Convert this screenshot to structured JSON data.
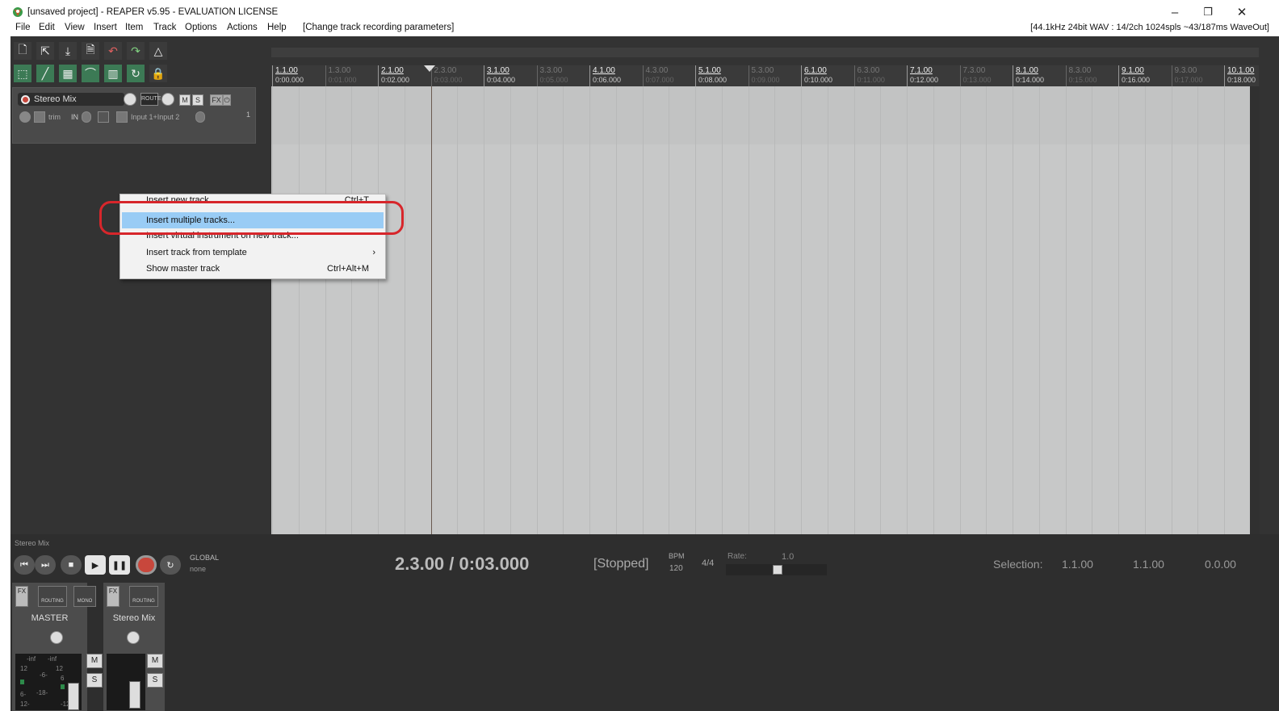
{
  "window": {
    "title": "[unsaved project] - REAPER v5.95 - EVALUATION LICENSE",
    "minimize": "–",
    "restore": "❐",
    "close": "✕"
  },
  "menubar": {
    "items": [
      "File",
      "Edit",
      "View",
      "Insert",
      "Item",
      "Track",
      "Options",
      "Actions",
      "Help"
    ],
    "hint": "[Change track recording parameters]",
    "status": "[44.1kHz 24bit WAV : 14/2ch 1024spls ~43/187ms WaveOut]"
  },
  "track": {
    "name": "Stereo Mix",
    "mute": "M",
    "solo": "S",
    "fx": "FX",
    "route": "ROUTE",
    "trim": "trim",
    "in": "IN",
    "input": "Input 1+Input 2",
    "number": "1"
  },
  "ruler": {
    "marks": [
      {
        "bar": "1.1.00",
        "time": "0:00.000",
        "minor": false
      },
      {
        "bar": "1.3.00",
        "time": "0:01.000",
        "minor": true
      },
      {
        "bar": "2.1.00",
        "time": "0:02.000",
        "minor": false
      },
      {
        "bar": "2.3.00",
        "time": "0:03.000",
        "minor": true
      },
      {
        "bar": "3.1.00",
        "time": "0:04.000",
        "minor": false
      },
      {
        "bar": "3.3.00",
        "time": "0:05.000",
        "minor": true
      },
      {
        "bar": "4.1.00",
        "time": "0:06.000",
        "minor": false
      },
      {
        "bar": "4.3.00",
        "time": "0:07.000",
        "minor": true
      },
      {
        "bar": "5.1.00",
        "time": "0:08.000",
        "minor": false
      },
      {
        "bar": "5.3.00",
        "time": "0:09.000",
        "minor": true
      },
      {
        "bar": "6.1.00",
        "time": "0:10.000",
        "minor": false
      },
      {
        "bar": "6.3.00",
        "time": "0:11.000",
        "minor": true
      },
      {
        "bar": "7.1.00",
        "time": "0:12.000",
        "minor": false
      },
      {
        "bar": "7.3.00",
        "time": "0:13.000",
        "minor": true
      },
      {
        "bar": "8.1.00",
        "time": "0:14.000",
        "minor": false
      },
      {
        "bar": "8.3.00",
        "time": "0:15.000",
        "minor": true
      },
      {
        "bar": "9.1.00",
        "time": "0:16.000",
        "minor": false
      },
      {
        "bar": "9.3.00",
        "time": "0:17.000",
        "minor": true
      },
      {
        "bar": "10.1.00",
        "time": "0:18.000",
        "minor": false
      }
    ]
  },
  "context_menu": {
    "items": [
      {
        "label": "Insert new track",
        "shortcut": "Ctrl+T"
      },
      {
        "label": "Insert multiple tracks...",
        "shortcut": ""
      },
      {
        "label": "Insert virtual instrument on new track...",
        "shortcut": ""
      },
      {
        "label": "Insert track from template",
        "shortcut": "›"
      },
      {
        "label": "Show master track",
        "shortcut": "Ctrl+Alt+M"
      }
    ],
    "highlighted": "Insert multiple tracks..."
  },
  "transport": {
    "track_label": "Stereo Mix",
    "global": "GLOBAL",
    "automation": "none",
    "position": "2.3.00 / 0:03.000",
    "state": "[Stopped]",
    "bpm_label": "BPM",
    "bpm": "120",
    "time_signature": "4/4",
    "rate_label": "Rate:",
    "rate": "1.0",
    "selection_label": "Selection:",
    "selection_start": "1.1.00",
    "selection_end": "1.1.00",
    "selection_length": "0.0.00"
  },
  "mixer": {
    "master": {
      "name": "MASTER",
      "mute": "M",
      "solo": "S",
      "fx": "FX",
      "routing": "ROUTING",
      "mono": "MONO"
    },
    "track1": {
      "name": "Stereo Mix",
      "mute": "M",
      "solo": "S",
      "fx": "FX",
      "routing": "ROUTING"
    },
    "meter_labels": [
      "-inf",
      "-inf",
      "12",
      "12",
      "-6-",
      "6",
      "-18-",
      "6-",
      "12-",
      "-12"
    ]
  }
}
